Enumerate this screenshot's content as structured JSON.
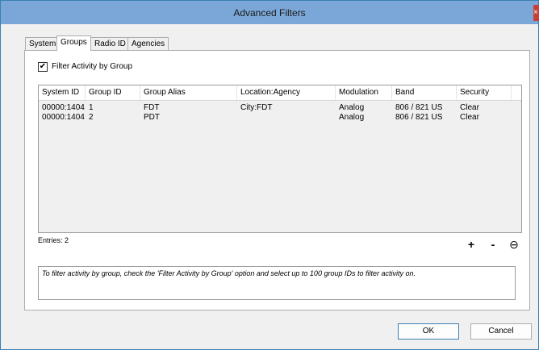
{
  "window": {
    "title": "Advanced Filters",
    "close_glyph": "×"
  },
  "tabs": [
    {
      "label": "System",
      "active": false
    },
    {
      "label": "Groups",
      "active": true
    },
    {
      "label": "Radio ID",
      "active": false
    },
    {
      "label": "Agencies",
      "active": false
    }
  ],
  "filter": {
    "label": "Filter Activity by Group",
    "checked": true,
    "check_glyph": "✔"
  },
  "grid": {
    "columns": [
      "System ID",
      "Group ID",
      "Group Alias",
      "Location:Agency",
      "Modulation",
      "Band",
      "Security"
    ],
    "rows": [
      [
        "00000:1404",
        "1",
        "FDT",
        "City:FDT",
        "Analog",
        "806 / 821 US",
        "Clear"
      ],
      [
        "00000:1404",
        "2",
        "PDT",
        "",
        "Analog",
        "806 / 821 US",
        "Clear"
      ]
    ]
  },
  "entries_label": "Entries: 2",
  "row_actions": {
    "add": "+",
    "remove": "-",
    "clear": "⊖"
  },
  "info_text": "To filter activity by group, check the 'Filter Activity by Group' option and select up to 100 group IDs to filter activity on.",
  "buttons": {
    "ok": "OK",
    "cancel": "Cancel"
  },
  "colors": {
    "titlebar": "#7aa7d7",
    "border": "#3c7fb1",
    "close": "#c7403a"
  }
}
